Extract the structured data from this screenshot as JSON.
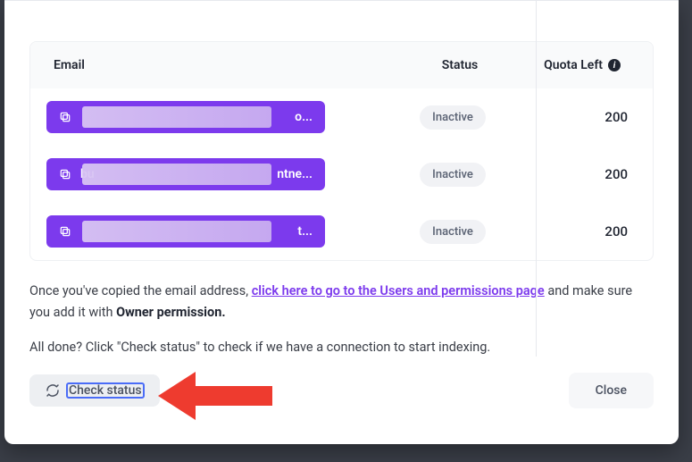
{
  "table": {
    "headers": {
      "email": "Email",
      "status": "Status",
      "quota": "Quota Left"
    },
    "rows": [
      {
        "email_prefix": "",
        "email_tail": "o...",
        "status": "Inactive",
        "quota": "200"
      },
      {
        "email_prefix": "bu",
        "email_tail": "ntne...",
        "status": "Inactive",
        "quota": "200"
      },
      {
        "email_prefix": "",
        "email_tail": "t...",
        "status": "Inactive",
        "quota": "200"
      }
    ]
  },
  "instructions": {
    "pre_link": "Once you've copied the email address, ",
    "link_text": "click here to go to the Users and permissions page",
    "post_link": " and make sure you add it with ",
    "bold": "Owner permission."
  },
  "confirm_line": "All done? Click \"Check status\" to check if we have a connection to start indexing.",
  "buttons": {
    "check_status": "Check status",
    "close": "Close"
  }
}
